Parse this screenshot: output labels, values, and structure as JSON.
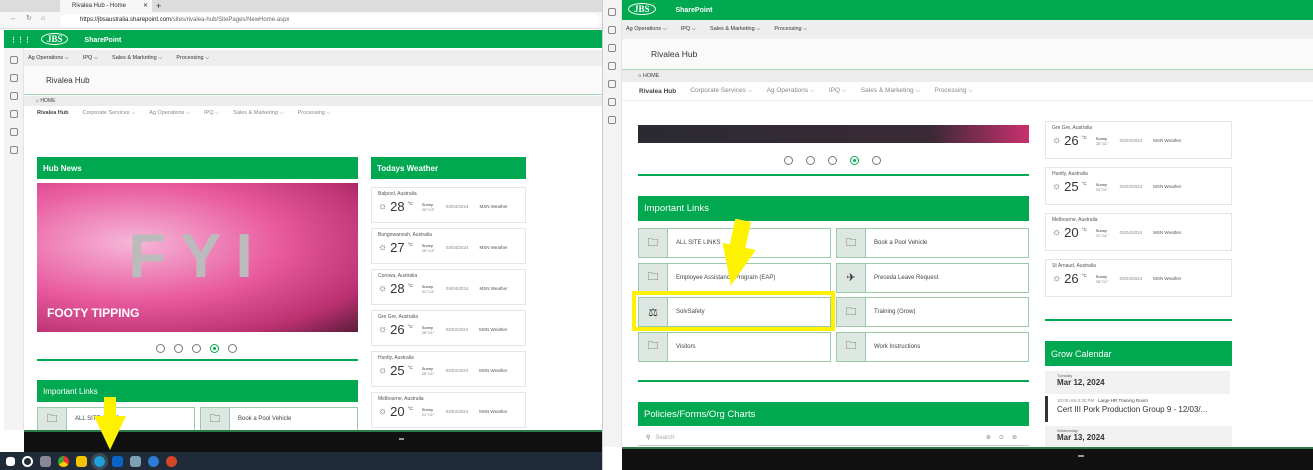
{
  "colors": {
    "brand": "#00a84f",
    "highlight": "#fff200"
  },
  "browser": {
    "tab_title": "Rivalea Hub - Home",
    "url_host": "https://jbsaustralia.sharepoint.com",
    "url_path": "/sites/rivalea-hub/SitePages/NewHome.aspx"
  },
  "sharepoint": {
    "logo": "JBS",
    "app": "SharePoint"
  },
  "topnav": [
    "Ag Operations ⌵",
    "IPQ ⌵",
    "Sales & Marketing ⌵",
    "Processing ⌵"
  ],
  "site": {
    "title": "Rivalea Hub",
    "breadcrumb": "⌂ HOME"
  },
  "subnav": [
    "Rivalea Hub",
    "Corporate Services ⌵",
    "Ag Operations ⌵",
    "IPQ ⌵",
    "Sales & Marketing ⌵",
    "Processing ⌵"
  ],
  "news": {
    "title": "Hub News",
    "image_text": "FYI",
    "caption": "FOOTY TIPPING",
    "active_dot": 4,
    "dot_count": 5
  },
  "weather": {
    "title": "Todays Weather",
    "cards": [
      {
        "city": "Balpool, Australia",
        "temp": "28",
        "unit": "°C",
        "cond": "Sunny",
        "range": "29°/13°",
        "date": "03/04/2024",
        "src": "MSN Weather"
      },
      {
        "city": "Bungowannah, Australia",
        "temp": "27",
        "unit": "°C",
        "cond": "Sunny",
        "range": "29°/13°",
        "date": "03/04/2024",
        "src": "MSN Weather"
      },
      {
        "city": "Corowa, Australia",
        "temp": "28",
        "unit": "°C",
        "cond": "Sunny",
        "range": "31°/14°",
        "date": "03/04/2024",
        "src": "MSN Weather"
      },
      {
        "city": "Gre Gre, Australia",
        "temp": "26",
        "unit": "°C",
        "cond": "Sunny",
        "range": "28°/11°",
        "date": "03/04/2024",
        "src": "MSN Weather"
      },
      {
        "city": "Huntly, Australia",
        "temp": "25",
        "unit": "°C",
        "cond": "Sunny",
        "range": "26°/11°",
        "date": "03/04/2024",
        "src": "MSN Weather"
      },
      {
        "city": "Melbourne, Australia",
        "temp": "20",
        "unit": "°C",
        "cond": "Sunny",
        "range": "21°/11°",
        "date": "03/04/2024",
        "src": "MSN Weather"
      },
      {
        "city": "St Arnaud, Australia",
        "temp": "26",
        "unit": "°C",
        "cond": "Sunny",
        "range": "28°/11°",
        "date": "03/04/2024",
        "src": "MSN Weather"
      }
    ]
  },
  "links": {
    "title": "Important Links",
    "items": [
      {
        "label": "ALL SITE LINKS",
        "icon": "folder"
      },
      {
        "label": "Book a Pool Vehicle",
        "icon": "folder"
      },
      {
        "label": "Employee Assistance Program (EAP)",
        "icon": "folder"
      },
      {
        "label": "Preceda Leave Request",
        "icon": "airplane"
      },
      {
        "label": "SolvSafety",
        "icon": "scales"
      },
      {
        "label": "Training (Grow)",
        "icon": "folder"
      },
      {
        "label": "Visitors",
        "icon": "folder"
      },
      {
        "label": "Work Instructions",
        "icon": "folder"
      }
    ]
  },
  "policies": {
    "title": "Policies/Forms/Org Charts",
    "search_placeholder": "Search"
  },
  "calendar": {
    "title": "Grow Calendar",
    "days": [
      {
        "weekday": "Tuesday",
        "date": "Mar 12, 2024"
      },
      {
        "weekday": "Wednesday",
        "date": "Mar 13, 2024"
      }
    ],
    "event": {
      "time": "10:00 AM-3:30 PM",
      "location": "Large HR Training Room",
      "title": "Cert III Pork Production Group 9 - 12/03/..."
    }
  }
}
